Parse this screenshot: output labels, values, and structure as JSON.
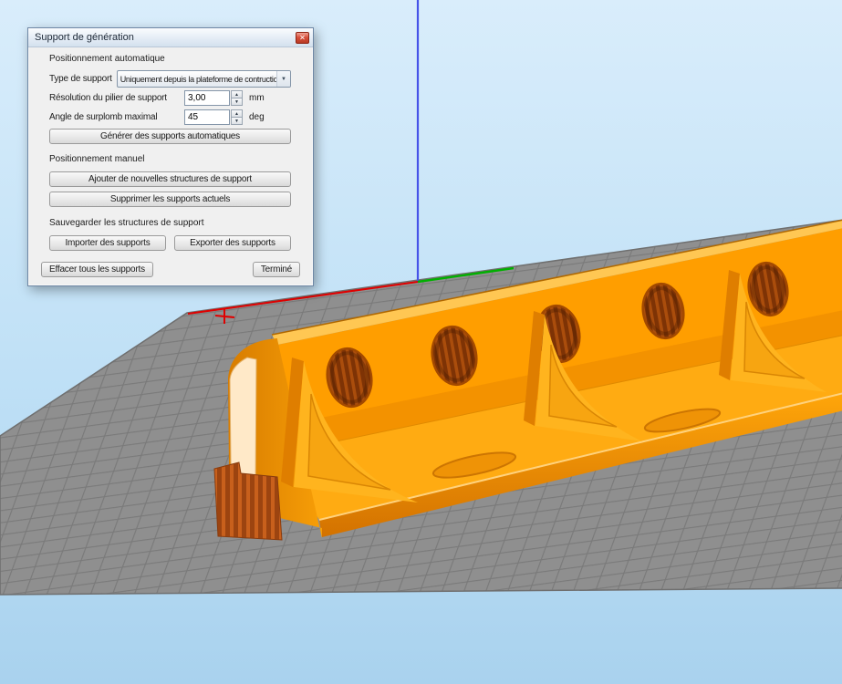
{
  "dialog": {
    "title": "Support de génération",
    "auto_section": {
      "heading": "Positionnement automatique",
      "type_label": "Type de support",
      "type_value": "Uniquement depuis la plateforme de contruction",
      "resolution_label": "Résolution du pilier de support",
      "resolution_value": "3,00",
      "resolution_unit": "mm",
      "angle_label": "Angle de surplomb maximal",
      "angle_value": "45",
      "angle_unit": "deg",
      "generate_button": "Générer des supports automatiques"
    },
    "manual_section": {
      "heading": "Positionnement manuel",
      "add_button": "Ajouter de nouvelles structures de support",
      "remove_button": "Supprimer les supports actuels"
    },
    "save_section": {
      "heading": "Sauvegarder les structures de support",
      "import_button": "Importer des supports",
      "export_button": "Exporter des supports"
    },
    "footer": {
      "clear_button": "Effacer tous les supports",
      "done_button": "Terminé"
    }
  },
  "icons": {
    "close": "✕",
    "chevron_down": "▼",
    "spin_up": "▲",
    "spin_down": "▼"
  },
  "scene": {
    "colors": {
      "sky_top": "#d9edfb",
      "sky_bottom": "#a9d2ee",
      "platform": "#8f8f8f",
      "grid_line": "#7a7a7a",
      "model": "#ff9e00",
      "model_light": "#ffc753",
      "model_shadow": "#e08200",
      "support_ribs": "#c8601c",
      "axis_x": "#e00000",
      "axis_y": "#00b000",
      "axis_z": "#4653e8"
    }
  }
}
